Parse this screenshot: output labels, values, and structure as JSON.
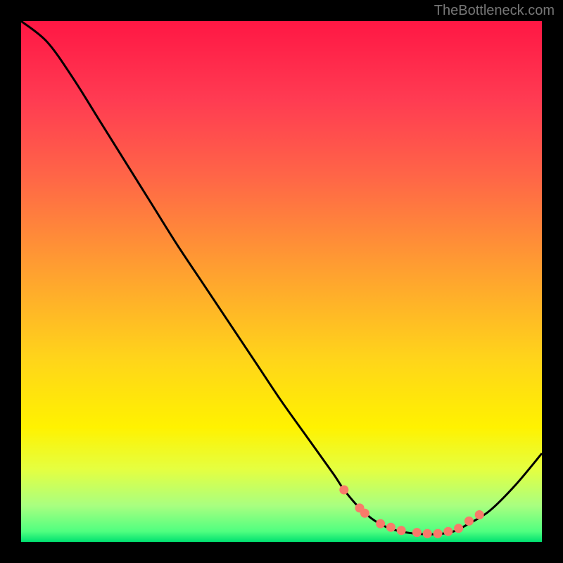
{
  "watermark": "TheBottleneck.com",
  "chart_data": {
    "type": "line",
    "title": "",
    "xlabel": "",
    "ylabel": "",
    "xlim": [
      0,
      100
    ],
    "ylim": [
      0,
      100
    ],
    "x": [
      0,
      5,
      10,
      15,
      20,
      25,
      30,
      35,
      40,
      45,
      50,
      55,
      60,
      62,
      65,
      68,
      71,
      74,
      77,
      80,
      83,
      86,
      90,
      95,
      100
    ],
    "values": [
      100,
      96,
      89,
      81,
      73,
      65,
      57,
      49.5,
      42,
      34.5,
      27,
      20,
      13,
      10,
      6.5,
      4,
      2.5,
      1.8,
      1.5,
      1.5,
      2,
      3.5,
      6,
      11,
      17
    ],
    "dots_x": [
      62,
      65,
      66,
      69,
      71,
      73,
      76,
      78,
      80,
      82,
      84,
      86,
      88
    ],
    "dots_y": [
      10,
      6.5,
      5.5,
      3.5,
      2.8,
      2.2,
      1.8,
      1.6,
      1.6,
      2,
      2.6,
      4,
      5.2
    ],
    "gradient_stops": [
      {
        "offset": 0.0,
        "color": "#ff1744"
      },
      {
        "offset": 0.15,
        "color": "#ff3b52"
      },
      {
        "offset": 0.3,
        "color": "#ff6647"
      },
      {
        "offset": 0.48,
        "color": "#ffa030"
      },
      {
        "offset": 0.65,
        "color": "#ffd51a"
      },
      {
        "offset": 0.78,
        "color": "#fff200"
      },
      {
        "offset": 0.86,
        "color": "#e5ff40"
      },
      {
        "offset": 0.93,
        "color": "#a9ff80"
      },
      {
        "offset": 0.98,
        "color": "#50ff80"
      },
      {
        "offset": 1.0,
        "color": "#00e070"
      }
    ],
    "dot_color": "#f87a6a",
    "line_color": "#000000"
  }
}
